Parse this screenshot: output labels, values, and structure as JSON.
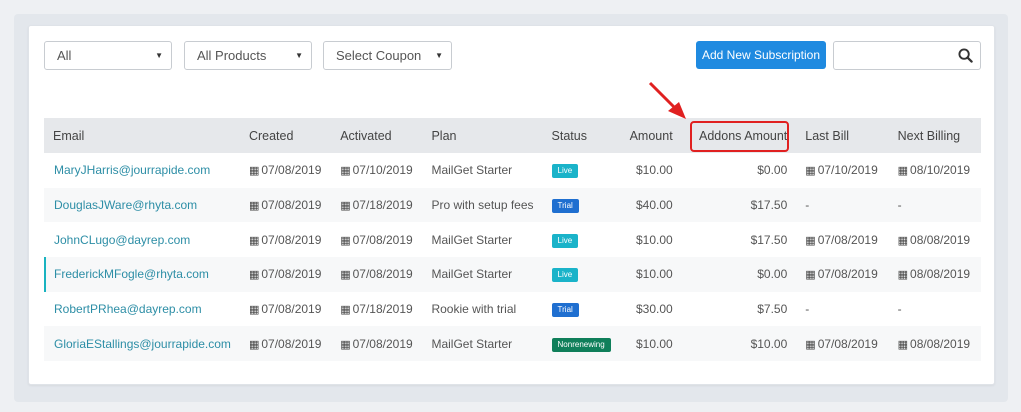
{
  "filters": {
    "status": {
      "value": "All"
    },
    "products": {
      "value": "All Products"
    },
    "coupon": {
      "value": "Select Coupon"
    }
  },
  "add_button_label": "Add New Subscription",
  "search": {
    "value": "",
    "placeholder": ""
  },
  "columns": [
    "Email",
    "Created",
    "Activated",
    "Plan",
    "Status",
    "Amount",
    "Addons Amount",
    "Last Bill",
    "Next Billing"
  ],
  "rows": [
    {
      "email": "MaryJHarris@jourrapide.com",
      "created": "07/08/2019",
      "activated": "07/10/2019",
      "plan": "MailGet Starter",
      "status": "Live",
      "amount": "$10.00",
      "addons": "$0.00",
      "last_bill": "07/10/2019",
      "next_billing": "08/10/2019"
    },
    {
      "email": "DouglasJWare@rhyta.com",
      "created": "07/08/2019",
      "activated": "07/18/2019",
      "plan": "Pro with setup fees",
      "status": "Trial",
      "amount": "$40.00",
      "addons": "$17.50",
      "last_bill": "-",
      "next_billing": "-"
    },
    {
      "email": "JohnCLugo@dayrep.com",
      "created": "07/08/2019",
      "activated": "07/08/2019",
      "plan": "MailGet Starter",
      "status": "Live",
      "amount": "$10.00",
      "addons": "$17.50",
      "last_bill": "07/08/2019",
      "next_billing": "08/08/2019"
    },
    {
      "email": "FrederickMFogle@rhyta.com",
      "created": "07/08/2019",
      "activated": "07/08/2019",
      "plan": "MailGet Starter",
      "status": "Live",
      "amount": "$10.00",
      "addons": "$0.00",
      "last_bill": "07/08/2019",
      "next_billing": "08/08/2019"
    },
    {
      "email": "RobertPRhea@dayrep.com",
      "created": "07/08/2019",
      "activated": "07/18/2019",
      "plan": "Rookie with trial",
      "status": "Trial",
      "amount": "$30.00",
      "addons": "$7.50",
      "last_bill": "-",
      "next_billing": "-"
    },
    {
      "email": "GloriaEStallings@jourrapide.com",
      "created": "07/08/2019",
      "activated": "07/08/2019",
      "plan": "MailGet Starter",
      "status": "Nonrenewing",
      "amount": "$10.00",
      "addons": "$10.00",
      "last_bill": "07/08/2019",
      "next_billing": "08/08/2019"
    }
  ],
  "selected_row": 3,
  "colors": {
    "accent": "#1f8ae0",
    "link": "#2d8ea6",
    "live": "#1ab3c9",
    "trial": "#1f6fd0",
    "nonrenewing": "#0f7f5a",
    "highlight": "#e02020"
  },
  "icons": {
    "search": "search-icon",
    "calendar": "calendar-icon",
    "dropdown": "caret-down-icon",
    "annotation_arrow": "arrow-icon"
  }
}
